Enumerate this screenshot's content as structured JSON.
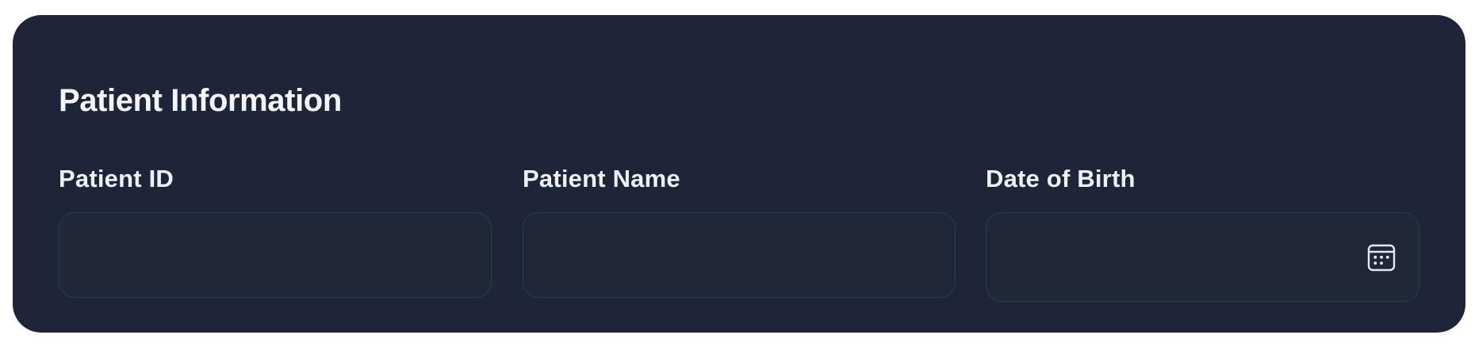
{
  "form": {
    "title": "Patient Information",
    "fields": [
      {
        "label": "Patient ID",
        "value": "",
        "placeholder": ""
      },
      {
        "label": "Patient Name",
        "value": "",
        "placeholder": ""
      },
      {
        "label": "Date of Birth",
        "value": "",
        "placeholder": "",
        "icon": "calendar-icon"
      }
    ]
  },
  "colors": {
    "card_background": "#1e2538",
    "input_background": "#1f2739",
    "input_border": "#2f3a50",
    "text": "#f3f5f9"
  }
}
